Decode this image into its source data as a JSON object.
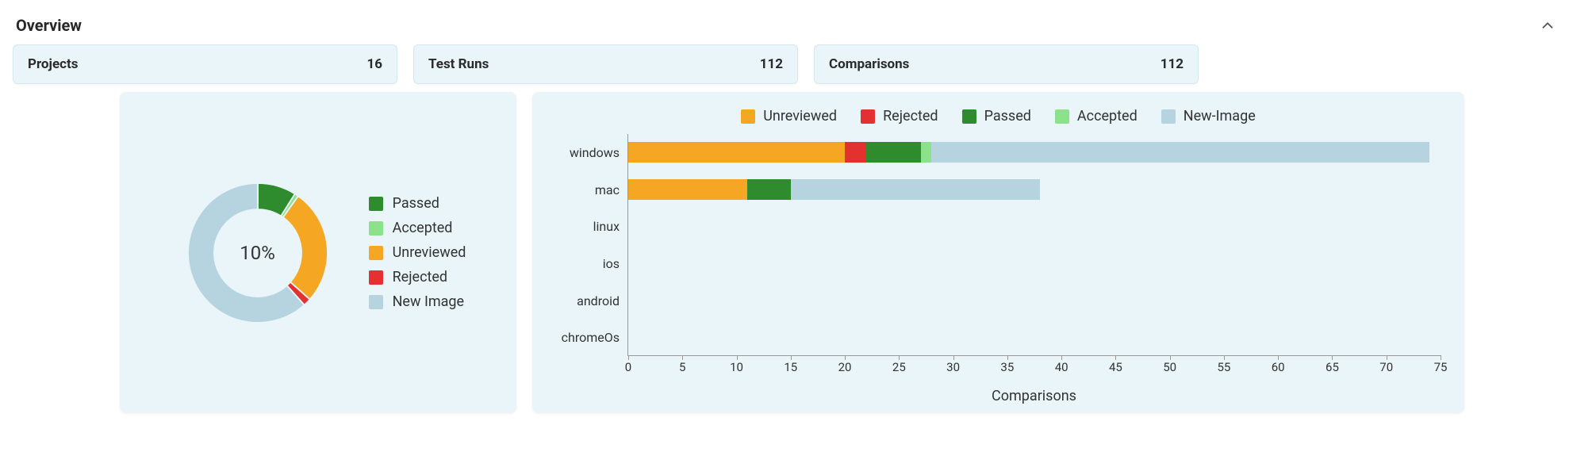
{
  "header": {
    "title": "Overview"
  },
  "stats": [
    {
      "label": "Projects",
      "value": "16"
    },
    {
      "label": "Test Runs",
      "value": "112"
    },
    {
      "label": "Comparisons",
      "value": "112"
    }
  ],
  "colors": {
    "unreviewed": "#f5a623",
    "rejected": "#e33131",
    "passed": "#2e8b2e",
    "accepted": "#8be28b",
    "new_image": "#b6d4e0"
  },
  "donut": {
    "center_label": "10%",
    "legend": [
      {
        "key": "passed",
        "label": "Passed"
      },
      {
        "key": "accepted",
        "label": "Accepted"
      },
      {
        "key": "unreviewed",
        "label": "Unreviewed"
      },
      {
        "key": "rejected",
        "label": "Rejected"
      },
      {
        "key": "new_image",
        "label": "New Image"
      }
    ]
  },
  "bar": {
    "legend": [
      {
        "key": "unreviewed",
        "label": "Unreviewed"
      },
      {
        "key": "rejected",
        "label": "Rejected"
      },
      {
        "key": "passed",
        "label": "Passed"
      },
      {
        "key": "accepted",
        "label": "Accepted"
      },
      {
        "key": "new_image",
        "label": "New-Image"
      }
    ],
    "xlabel": "Comparisons",
    "xmax": 75,
    "xticks": [
      0,
      5,
      10,
      15,
      20,
      25,
      30,
      35,
      40,
      45,
      50,
      55,
      60,
      65,
      70,
      75
    ]
  },
  "chart_data": [
    {
      "type": "pie",
      "title": "",
      "center_label": "10%",
      "series": [
        {
          "name": "Passed",
          "value": 10
        },
        {
          "name": "Accepted",
          "value": 1
        },
        {
          "name": "Unreviewed",
          "value": 30
        },
        {
          "name": "Rejected",
          "value": 2
        },
        {
          "name": "New Image",
          "value": 69
        }
      ]
    },
    {
      "type": "bar",
      "orientation": "horizontal",
      "stacked": true,
      "title": "",
      "xlabel": "Comparisons",
      "ylabel": "",
      "xlim": [
        0,
        75
      ],
      "categories": [
        "windows",
        "mac",
        "linux",
        "ios",
        "android",
        "chromeOs"
      ],
      "series": [
        {
          "name": "Unreviewed",
          "values": [
            20,
            11,
            0,
            0,
            0,
            0
          ]
        },
        {
          "name": "Rejected",
          "values": [
            2,
            0,
            0,
            0,
            0,
            0
          ]
        },
        {
          "name": "Passed",
          "values": [
            5,
            4,
            0,
            0,
            0,
            0
          ]
        },
        {
          "name": "Accepted",
          "values": [
            1,
            0,
            0,
            0,
            0,
            0
          ]
        },
        {
          "name": "New-Image",
          "values": [
            46,
            23,
            0,
            0,
            0,
            0
          ]
        }
      ]
    }
  ]
}
